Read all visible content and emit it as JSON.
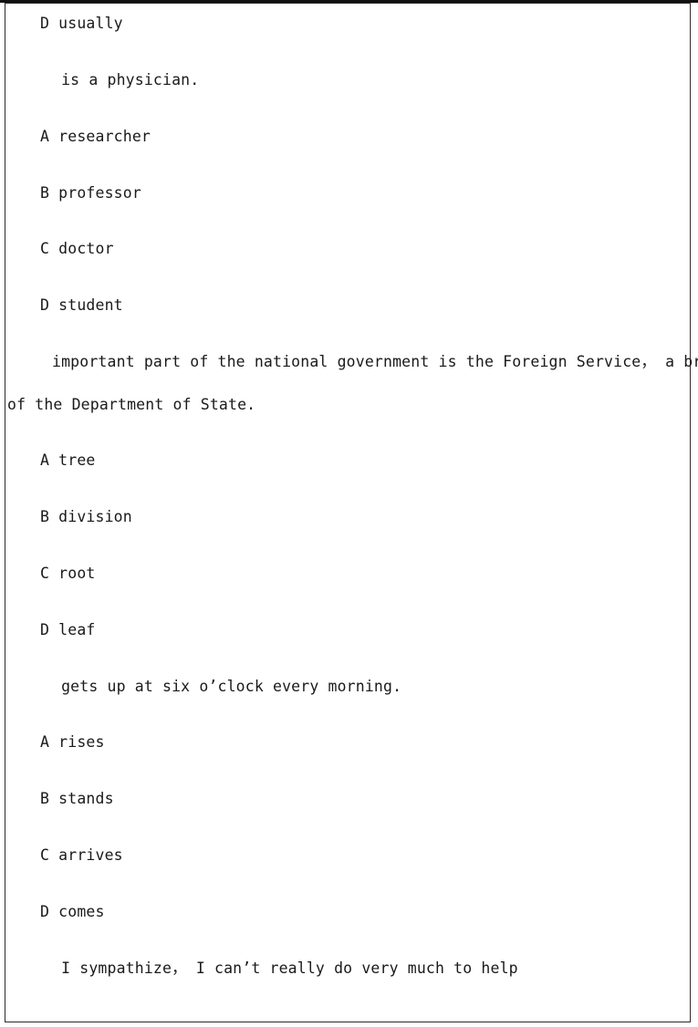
{
  "document": {
    "page_background": "#ffffff",
    "text_color": "#1a1a1a",
    "border_color": "#2a2a2a",
    "lines": [
      {
        "id": "opt-d-usually",
        "text": "D usually",
        "indent": "option"
      },
      {
        "id": "stem-physician",
        "text": " is a physician.",
        "indent": "para"
      },
      {
        "id": "opt-a-researcher",
        "text": "A researcher",
        "indent": "option"
      },
      {
        "id": "opt-b-professor",
        "text": "B professor",
        "indent": "option"
      },
      {
        "id": "opt-c-doctor",
        "text": "C doctor",
        "indent": "option"
      },
      {
        "id": "opt-d-student",
        "text": "D student",
        "indent": "option"
      },
      {
        "id": "stem-foreign-service",
        "text": "important part of the national government is the Foreign Service， a branch",
        "indent": "para"
      },
      {
        "id": "stem-foreign-service-cont",
        "text": "of the Department of State.",
        "indent": "cont"
      },
      {
        "id": "opt-a-tree",
        "text": "A tree",
        "indent": "option"
      },
      {
        "id": "opt-b-division",
        "text": "B division",
        "indent": "option"
      },
      {
        "id": "opt-c-root",
        "text": "C root",
        "indent": "option"
      },
      {
        "id": "opt-d-leaf",
        "text": "D leaf",
        "indent": "option"
      },
      {
        "id": "stem-gets-up",
        "text": " gets up at six o’clock every morning.",
        "indent": "para"
      },
      {
        "id": "opt-a-rises",
        "text": "A rises",
        "indent": "option"
      },
      {
        "id": "opt-b-stands",
        "text": "B stands",
        "indent": "option"
      },
      {
        "id": "opt-c-arrives",
        "text": "C arrives",
        "indent": "option"
      },
      {
        "id": "opt-d-comes",
        "text": "D comes",
        "indent": "option"
      },
      {
        "id": "stem-sympathize",
        "text": " I sympathize， I can’t really do very much to help",
        "indent": "para"
      }
    ]
  }
}
